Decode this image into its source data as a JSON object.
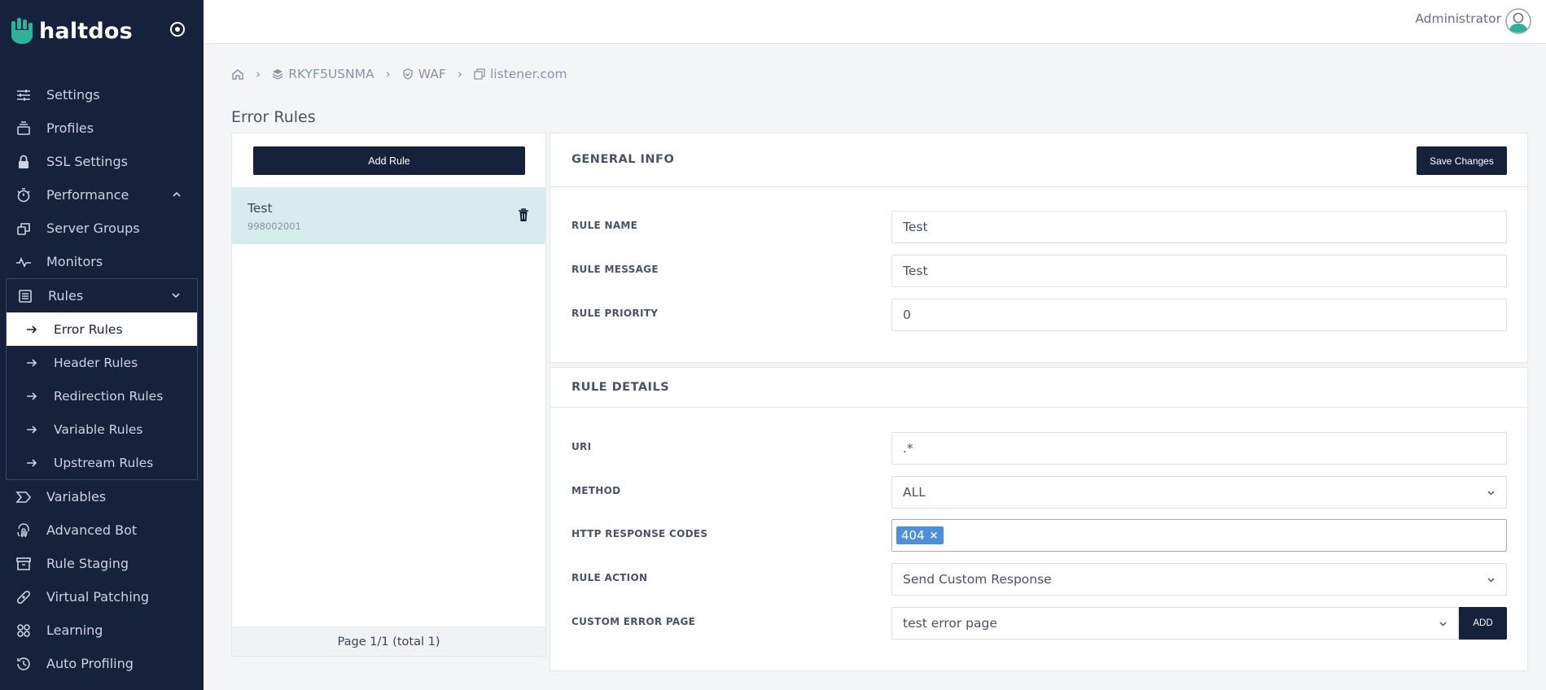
{
  "brand": {
    "name": "haltdos"
  },
  "header": {
    "user_name": "Administrator"
  },
  "sidebar": {
    "items": [
      {
        "label": "Settings",
        "icon": "sliders-icon"
      },
      {
        "label": "Profiles",
        "icon": "stack-icon"
      },
      {
        "label": "SSL Settings",
        "icon": "lock-icon"
      },
      {
        "label": "Performance",
        "icon": "stopwatch-icon"
      },
      {
        "label": "Server Groups",
        "icon": "server-group-icon"
      },
      {
        "label": "Monitors",
        "icon": "pulse-icon"
      }
    ],
    "rules_group": {
      "label": "Rules",
      "icon": "list-icon",
      "items": [
        {
          "label": "Error Rules",
          "active": true
        },
        {
          "label": "Header Rules"
        },
        {
          "label": "Redirection Rules"
        },
        {
          "label": "Variable Rules"
        },
        {
          "label": "Upstream Rules"
        }
      ]
    },
    "items_after": [
      {
        "label": "Variables",
        "icon": "tag-icon"
      },
      {
        "label": "Advanced Bot",
        "icon": "fingerprint-icon"
      },
      {
        "label": "Rule Staging",
        "icon": "archive-icon"
      },
      {
        "label": "Virtual Patching",
        "icon": "bandage-icon"
      },
      {
        "label": "Learning",
        "icon": "nodes-icon"
      },
      {
        "label": "Auto Profiling",
        "icon": "history-icon"
      }
    ]
  },
  "breadcrumb": [
    {
      "label": "",
      "icon": "home-icon"
    },
    {
      "label": "RKYF5USNMA",
      "icon": "layers-icon"
    },
    {
      "label": "WAF",
      "icon": "shield-icon"
    },
    {
      "label": "listener.com",
      "icon": "window-icon"
    }
  ],
  "page": {
    "title": "Error Rules"
  },
  "rule_list": {
    "add_label": "Add Rule",
    "items": [
      {
        "name": "Test",
        "id": "998002001"
      }
    ],
    "pagination": "Page 1/1 (total 1)"
  },
  "general_info": {
    "title": "GENERAL INFO",
    "save_label": "Save Changes",
    "rule_name_label": "RULE NAME",
    "rule_name_value": "Test",
    "rule_message_label": "RULE MESSAGE",
    "rule_message_value": "Test",
    "rule_priority_label": "RULE PRIORITY",
    "rule_priority_value": "0"
  },
  "rule_details": {
    "title": "RULE DETAILS",
    "uri_label": "URI",
    "uri_value": ".*",
    "method_label": "METHOD",
    "method_value": "ALL",
    "codes_label": "HTTP RESPONSE CODES",
    "codes": [
      "404"
    ],
    "action_label": "RULE ACTION",
    "action_value": "Send Custom Response",
    "error_page_label": "CUSTOM ERROR PAGE",
    "error_page_value": "test error page",
    "add_label": "ADD"
  },
  "colors": {
    "sidebar_bg": "#16213c",
    "accent": "#16213c",
    "selected_row": "#d7eced",
    "tag": "#4a90e2"
  }
}
